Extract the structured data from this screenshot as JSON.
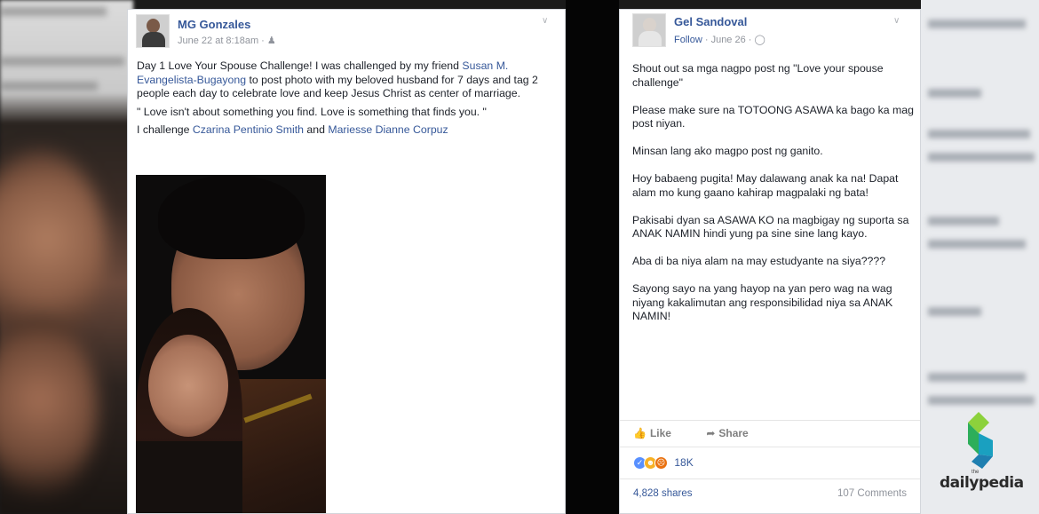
{
  "left_post": {
    "author": "MG Gonzales",
    "timestamp": "June 22 at 8:18am · ",
    "audience_icon": "friends-icon",
    "text_intro": "Day 1 Love Your Spouse Challenge! I was challenged by my friend ",
    "text_tag": "Susan M. Evangelista-Bugayong",
    "text_rest": " to post photo with my beloved husband for 7 days and tag 2 people each day to celebrate love and keep Jesus Christ as center of marriage.",
    "quote": "\" Love isn't about something you find. Love is something that finds you. \"",
    "challenge_prefix": "I challenge ",
    "challenge_tag1": "Czarina Pentinio Smith",
    "challenge_and": " and ",
    "challenge_tag2": "Mariesse Dianne Corpuz"
  },
  "right_post": {
    "author": "Gel Sandoval",
    "follow": "Follow",
    "timestamp": " · June 26 · ",
    "audience_icon": "globe-icon",
    "paragraphs": [
      "Shout out sa mga nagpo post ng \"Love your spouse challenge\"",
      "Please make sure na TOTOONG ASAWA ka bago ka mag post niyan.",
      "Minsan lang ako magpo post ng ganito.",
      "Hoy babaeng pugita! May dalawang anak ka na! Dapat alam mo kung gaano kahirap magpalaki ng bata!",
      "Pakisabi dyan sa ASAWA KO na magbigay ng suporta sa ANAK NAMIN hindi yung pa sine sine lang kayo.",
      "Aba di ba niya alam na may estudyante na siya????",
      "Sayong sayo na yang hayop na yan pero wag na wag niyang kakalimutan ang responsibilidad niya sa ANAK NAMIN!"
    ],
    "like_label": "Like",
    "share_label": "Share",
    "reaction_count": "18K",
    "shares": "4,828 shares",
    "comments": "107 Comments"
  },
  "logo": {
    "small": "the",
    "name": "dailypedia"
  },
  "colors": {
    "link": "#365899",
    "logo_green": "#5cc24b",
    "logo_teal": "#1aa0c0"
  }
}
